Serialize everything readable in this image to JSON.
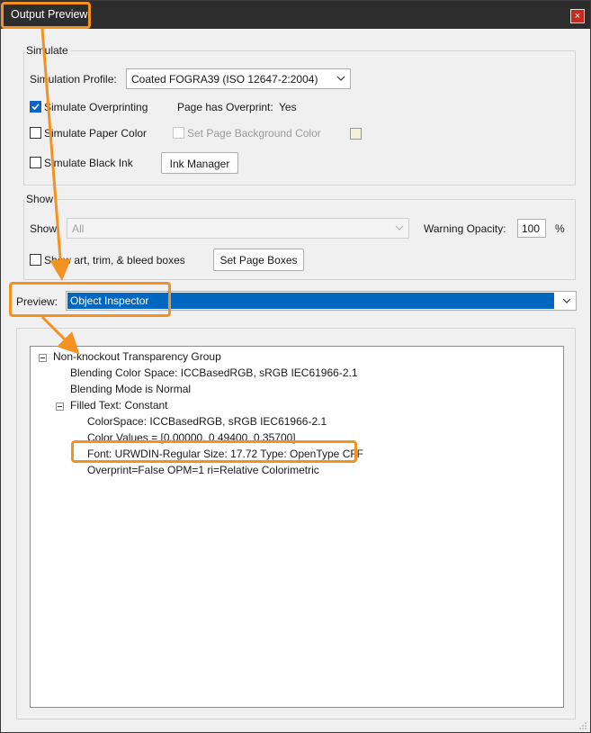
{
  "window": {
    "title": "Output Preview",
    "close_glyph": "×"
  },
  "simulate": {
    "group_label": "Simulate",
    "profile_label": "Simulation Profile:",
    "profile_value": "Coated FOGRA39 (ISO 12647-2:2004)",
    "overprinting_label": "Simulate Overprinting",
    "overprinting_checked": true,
    "page_overprint_label": "Page has Overprint:",
    "page_overprint_value": "Yes",
    "paper_color_label": "Simulate Paper Color",
    "page_bg_label": "Set Page Background Color",
    "black_ink_label": "Simulate Black Ink",
    "ink_manager_label": "Ink Manager"
  },
  "show": {
    "group_label": "Show",
    "show_label": "Show:",
    "show_value": "All",
    "warning_opacity_label": "Warning Opacity:",
    "warning_opacity_value": "100",
    "percent_label": "%",
    "art_boxes_label": "Show art, trim, & bleed boxes",
    "set_page_boxes_label": "Set Page Boxes"
  },
  "preview": {
    "label": "Preview:",
    "value": "Object Inspector"
  },
  "tree": {
    "root": "Non-knockout Transparency Group",
    "blending_space": "Blending Color Space: ICCBasedRGB, sRGB IEC61966-2.1",
    "blending_mode": "Blending Mode is Normal",
    "filled_text": "Filled Text: Constant",
    "color_space": "ColorSpace: ICCBasedRGB, sRGB IEC61966-2.1",
    "color_values": "Color Values = [0.00000, 0.49400, 0.35700]",
    "font": "Font: URWDIN-Regular Size: 17.72 Type: OpenType CFF",
    "overprint": "Overprint=False OPM=1 ri=Relative Colorimetric"
  },
  "colors": {
    "highlight": "#f39121",
    "selection": "#0067c0",
    "titlebar": "#2d2d2d"
  }
}
